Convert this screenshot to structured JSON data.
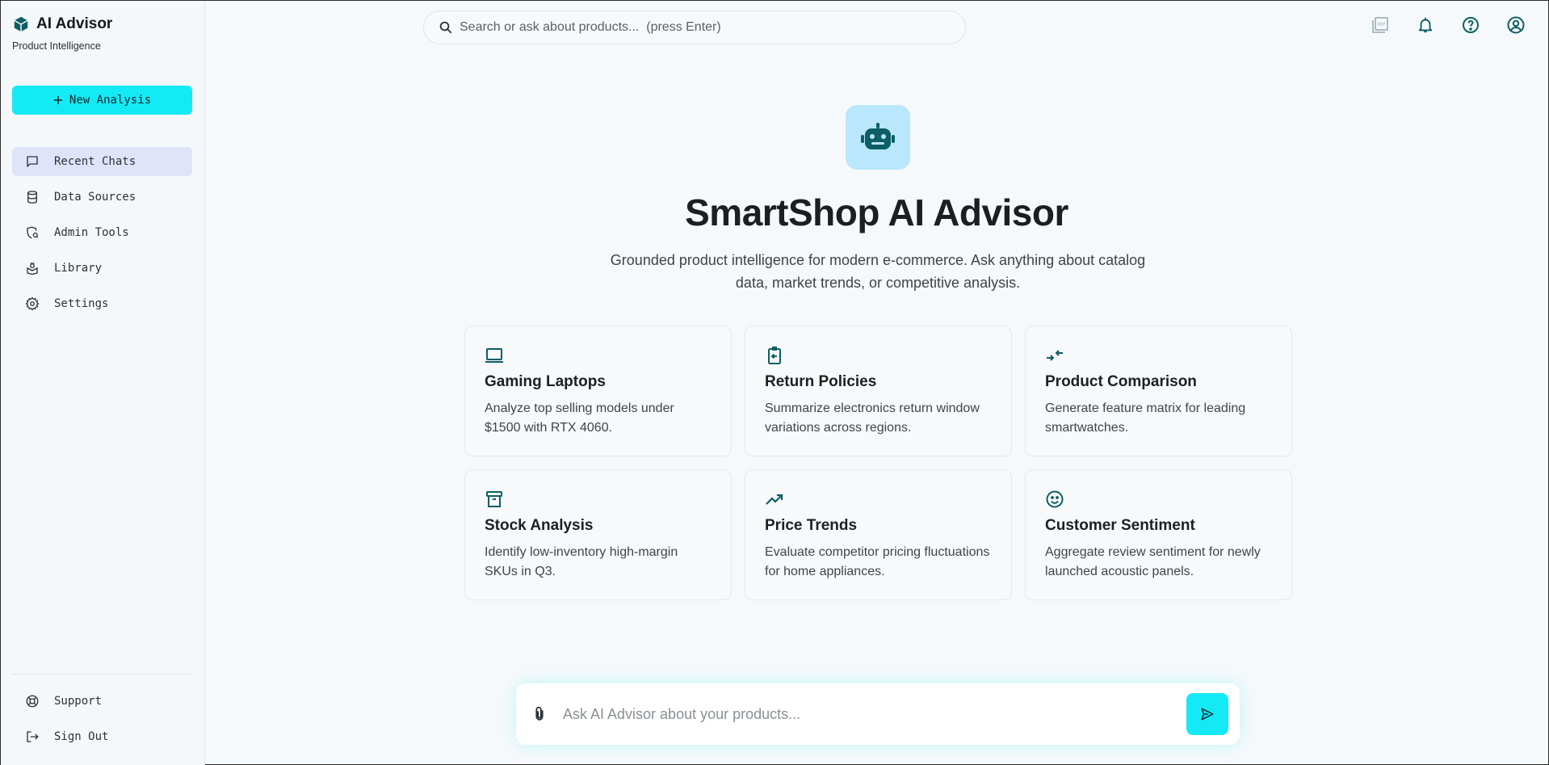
{
  "brand": {
    "name": "AI Advisor",
    "subtitle": "Product Intelligence",
    "icon": "cube-icon"
  },
  "sidebar": {
    "new_button": {
      "icon": "plus-icon",
      "label": "New Analysis"
    },
    "items": [
      {
        "label": "Recent Chats",
        "icon": "chat-icon",
        "active": true
      },
      {
        "label": "Data Sources",
        "icon": "database-icon",
        "active": false
      },
      {
        "label": "Admin Tools",
        "icon": "admin-shield-icon",
        "active": false
      },
      {
        "label": "Library",
        "icon": "library-icon",
        "active": false
      },
      {
        "label": "Settings",
        "icon": "gear-icon",
        "active": false
      }
    ],
    "bottom_items": [
      {
        "label": "Support",
        "icon": "support-icon"
      },
      {
        "label": "Sign Out",
        "icon": "sign-out-icon"
      }
    ]
  },
  "search": {
    "placeholder": "Search or ask about products...  (press Enter)"
  },
  "topbar_icons": [
    "pdf-icon",
    "bell-icon",
    "help-icon",
    "account-icon"
  ],
  "hero": {
    "icon": "robot-icon",
    "title": "SmartShop AI Advisor",
    "subtitle": "Grounded product intelligence for modern e-commerce. Ask anything about catalog data, market trends, or competitive analysis."
  },
  "cards": [
    {
      "icon": "laptop-icon",
      "title": "Gaming Laptops",
      "desc": "Analyze top selling models under $1500 with RTX 4060."
    },
    {
      "icon": "return-icon",
      "title": "Return Policies",
      "desc": "Summarize electronics return window variations across regions."
    },
    {
      "icon": "compare-icon",
      "title": "Product Comparison",
      "desc": "Generate feature matrix for leading smartwatches."
    },
    {
      "icon": "archive-icon",
      "title": "Stock Analysis",
      "desc": "Identify low-inventory high-margin SKUs in Q3."
    },
    {
      "icon": "trend-icon",
      "title": "Price Trends",
      "desc": "Evaluate competitor pricing fluctuations for home appliances."
    },
    {
      "icon": "smile-icon",
      "title": "Customer Sentiment",
      "desc": "Aggregate review sentiment for newly launched acoustic panels."
    }
  ],
  "composer": {
    "placeholder": "Ask AI Advisor about your products...",
    "attach_icon": "paperclip-icon",
    "send_icon": "send-icon"
  },
  "colors": {
    "accent": "#14eaf6",
    "brand_teal": "#0e5e66",
    "active_nav": "#dfe4fb",
    "hero_icon_bg": "#b9e7fb"
  }
}
